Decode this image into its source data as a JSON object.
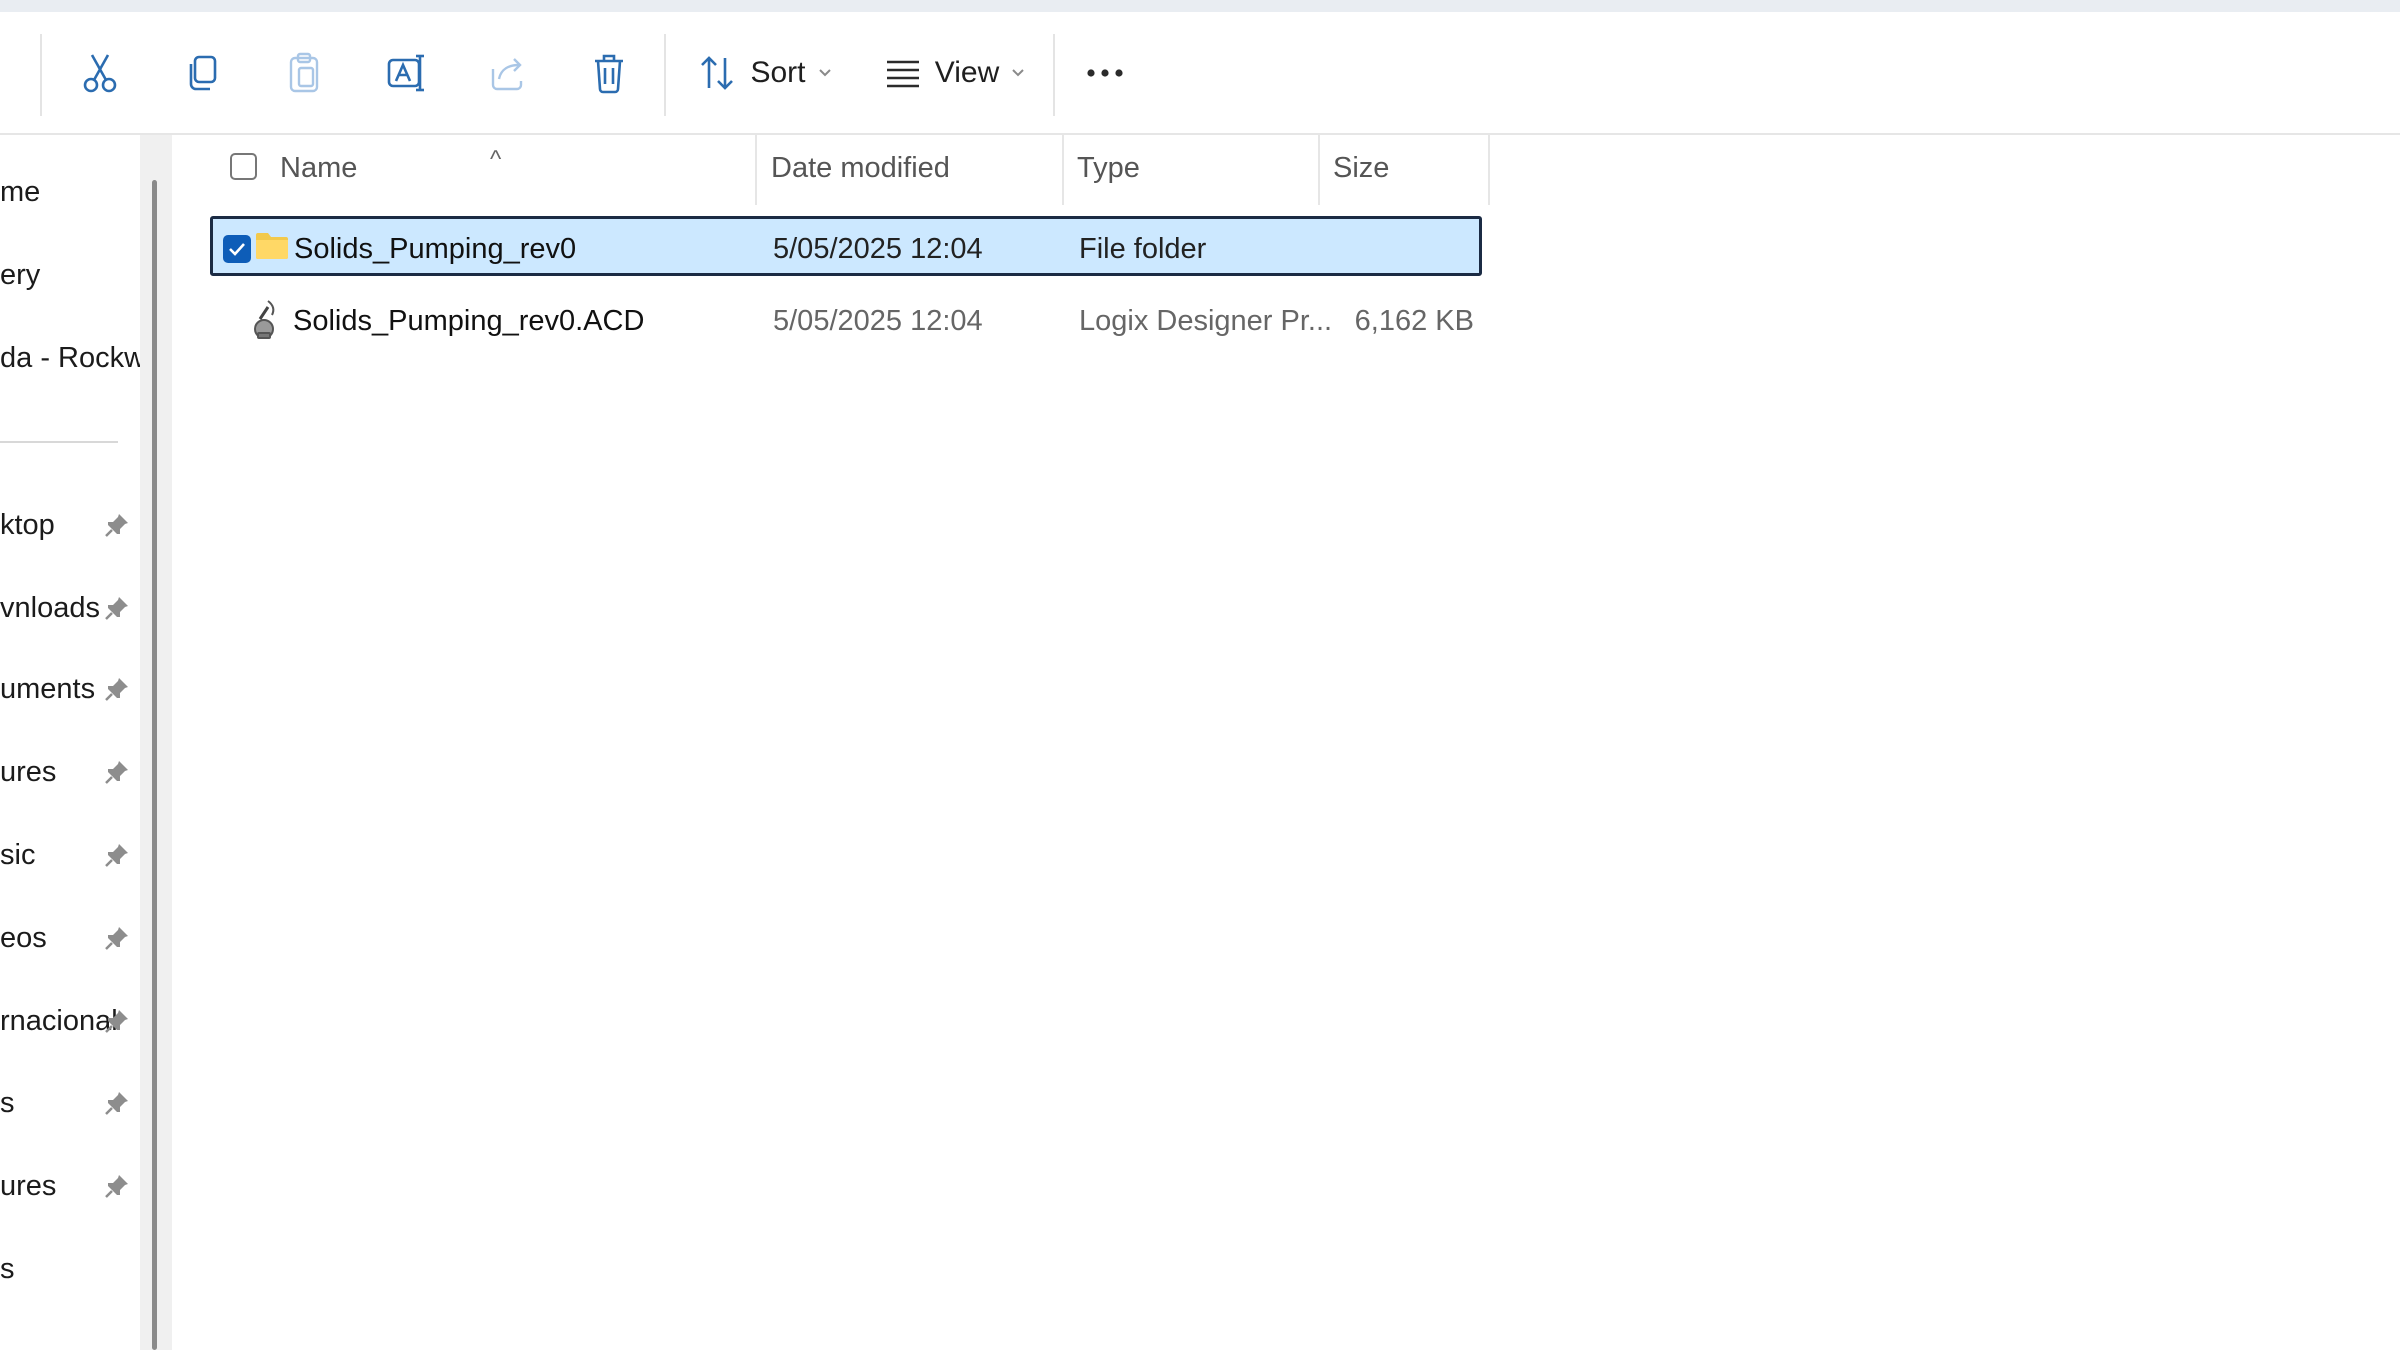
{
  "toolbar": {
    "cut_icon": "scissors-icon",
    "copy_icon": "copy-icon",
    "paste_icon": "clipboard-icon",
    "rename_icon": "rename-icon",
    "share_icon": "share-icon",
    "delete_icon": "trash-icon",
    "sort_label": "Sort",
    "view_label": "View",
    "more_label": "···"
  },
  "sidebar": {
    "items": [
      {
        "label": "me",
        "pinned": false
      },
      {
        "label": "ery",
        "pinned": false
      },
      {
        "label": "da - Rockwel",
        "pinned": false
      },
      {
        "label": "ktop",
        "pinned": true
      },
      {
        "label": "vnloads",
        "pinned": true
      },
      {
        "label": "uments",
        "pinned": true
      },
      {
        "label": "ures",
        "pinned": true
      },
      {
        "label": "sic",
        "pinned": true
      },
      {
        "label": "eos",
        "pinned": true
      },
      {
        "label": "rnacional",
        "pinned": true
      },
      {
        "label": "s",
        "pinned": true
      },
      {
        "label": "ures",
        "pinned": true
      },
      {
        "label": "s",
        "pinned": false
      }
    ]
  },
  "columns": {
    "name": "Name",
    "date": "Date modified",
    "type": "Type",
    "size": "Size",
    "sort_indicator": "^"
  },
  "files": [
    {
      "name": "Solids_Pumping_rev0",
      "date": "5/05/2025 12:04",
      "type": "File folder",
      "size": "",
      "icon": "folder-icon",
      "selected": true
    },
    {
      "name": "Solids_Pumping_rev0.ACD",
      "date": "5/05/2025 12:04",
      "type": "Logix Designer Pr...",
      "size": "6,162 KB",
      "icon": "logix-file-icon",
      "selected": false
    }
  ],
  "colors": {
    "selection_fill": "#cce8ff",
    "selection_border": "#1b2b44",
    "checkbox_accent": "#0e5db8",
    "toolbar_icon": "#2b6cb0",
    "folder": "#f2c94c"
  }
}
